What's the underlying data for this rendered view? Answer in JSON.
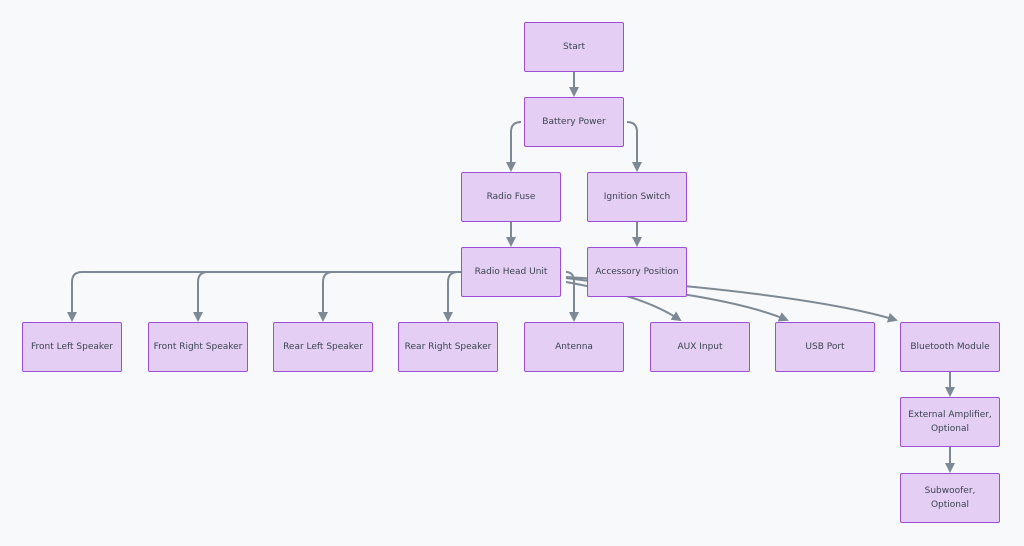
{
  "diagram": {
    "type": "flowchart",
    "colors": {
      "background": "#f8f9fa",
      "node_fill": "#e4cef4",
      "node_border": "#9b4fd8",
      "edge": "#7d8a96",
      "text": "#3b4452"
    },
    "nodes": [
      {
        "id": "start",
        "label": "Start"
      },
      {
        "id": "battery",
        "label": "Battery Power"
      },
      {
        "id": "fuse",
        "label": "Radio Fuse"
      },
      {
        "id": "ignition",
        "label": "Ignition Switch"
      },
      {
        "id": "head",
        "label": "Radio Head Unit"
      },
      {
        "id": "accessory",
        "label": "Accessory Position"
      },
      {
        "id": "fl",
        "label": "Front Left Speaker"
      },
      {
        "id": "fr",
        "label": "Front Right Speaker"
      },
      {
        "id": "rl",
        "label": "Rear Left Speaker"
      },
      {
        "id": "rr",
        "label": "Rear Right Speaker"
      },
      {
        "id": "antenna",
        "label": "Antenna"
      },
      {
        "id": "aux",
        "label": "AUX Input"
      },
      {
        "id": "usb",
        "label": "USB Port"
      },
      {
        "id": "bt",
        "label": "Bluetooth Module"
      },
      {
        "id": "amp",
        "label": "External Amplifier, Optional"
      },
      {
        "id": "sub",
        "label": "Subwoofer, Optional"
      }
    ],
    "edges": [
      [
        "start",
        "battery"
      ],
      [
        "battery",
        "fuse"
      ],
      [
        "battery",
        "ignition"
      ],
      [
        "fuse",
        "head"
      ],
      [
        "ignition",
        "accessory"
      ],
      [
        "head",
        "fl"
      ],
      [
        "head",
        "fr"
      ],
      [
        "head",
        "rl"
      ],
      [
        "head",
        "rr"
      ],
      [
        "head",
        "antenna"
      ],
      [
        "head",
        "aux"
      ],
      [
        "head",
        "usb"
      ],
      [
        "head",
        "bt"
      ],
      [
        "bt",
        "amp"
      ],
      [
        "amp",
        "sub"
      ]
    ]
  }
}
